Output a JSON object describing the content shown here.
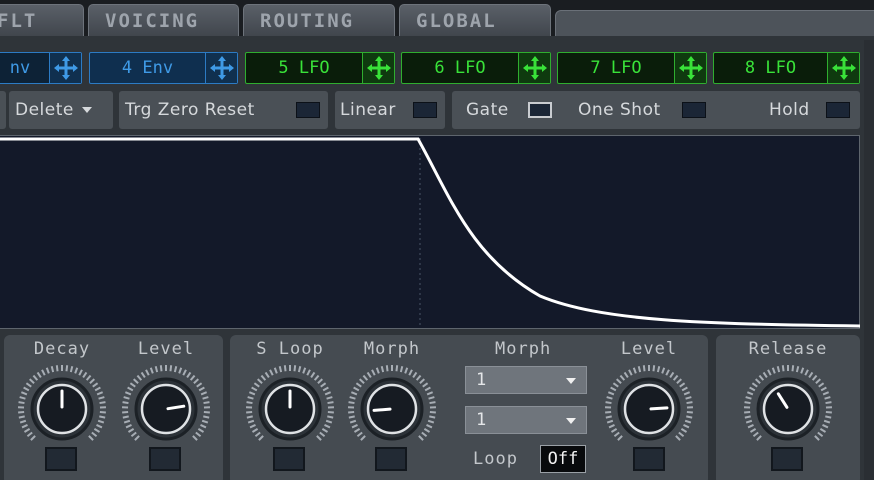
{
  "tabs": [
    {
      "label": "FLT"
    },
    {
      "label": "VOICING"
    },
    {
      "label": "ROUTING"
    },
    {
      "label": "GLOBAL"
    }
  ],
  "mod_sources": [
    {
      "label": "nv",
      "kind": "env"
    },
    {
      "label": "4 Env",
      "kind": "env",
      "active": true
    },
    {
      "label": "5 LFO",
      "kind": "lfo"
    },
    {
      "label": "6 LFO",
      "kind": "lfo"
    },
    {
      "label": "7 LFO",
      "kind": "lfo"
    },
    {
      "label": "8 LFO",
      "kind": "lfo"
    }
  ],
  "options": {
    "delete_label": "Delete",
    "trg_zero_reset_label": "Trg Zero Reset",
    "linear_label": "Linear",
    "gate_label": "Gate",
    "one_shot_label": "One Shot",
    "hold_label": "Hold"
  },
  "knobs": {
    "decay": {
      "label": "Decay",
      "value": 0.5
    },
    "level1": {
      "label": "Level",
      "value": 0.8
    },
    "s_loop": {
      "label": "S Loop",
      "value": 0.5
    },
    "morph1": {
      "label": "Morph",
      "value": 0.15
    },
    "level2": {
      "label": "Level",
      "value": 0.82
    },
    "release": {
      "label": "Release",
      "value": 0.38
    }
  },
  "morph_panel": {
    "label": "Morph",
    "dropdown1": "1",
    "dropdown2": "1",
    "loop_label": "Loop",
    "loop_value": "Off"
  },
  "colors": {
    "env_accent": "#3f9ae6",
    "lfo_accent": "#39e239",
    "graph_bg": "#131929",
    "curve": "#ffffff"
  }
}
